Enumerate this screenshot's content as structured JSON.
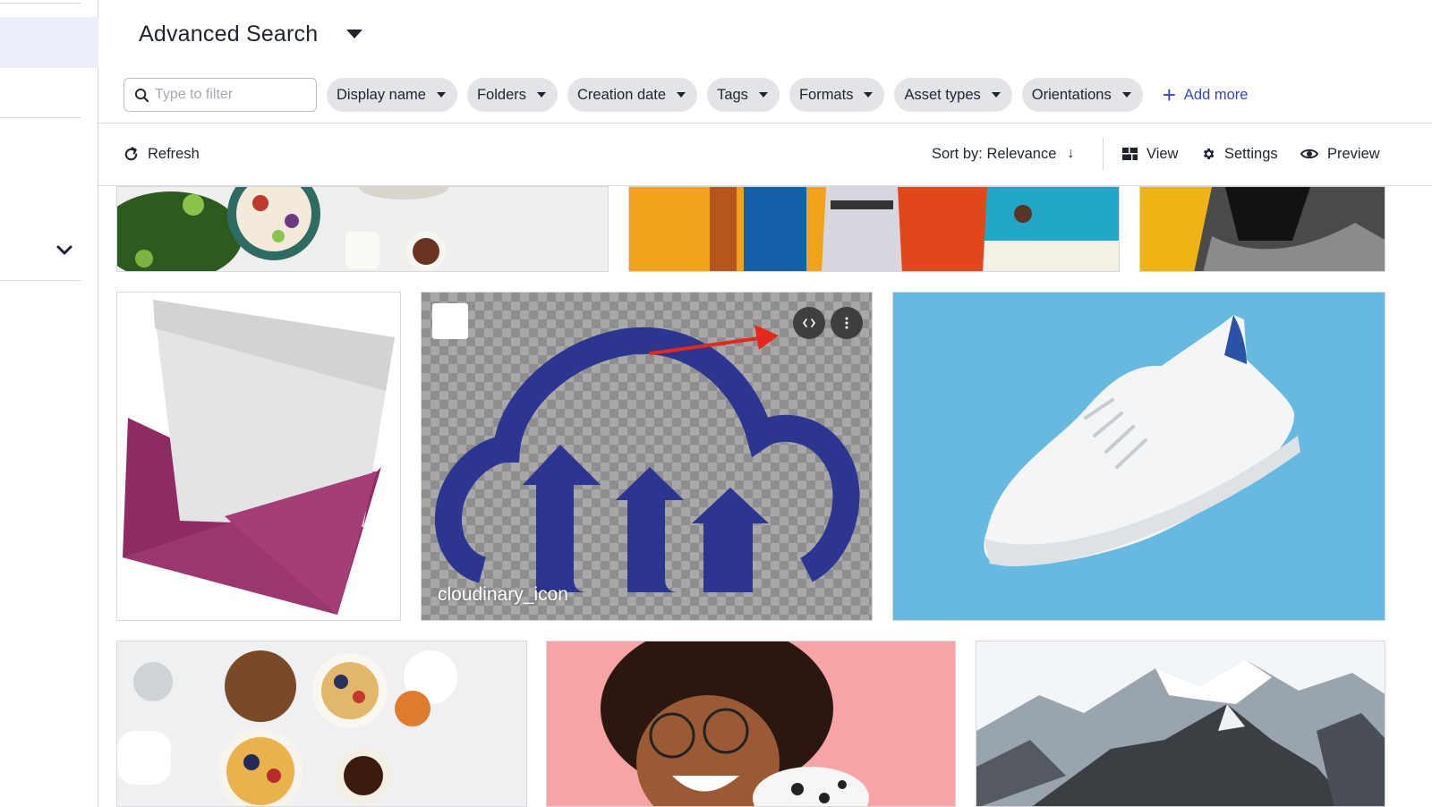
{
  "header": {
    "title": "Advanced Search"
  },
  "filters": {
    "search_placeholder": "Type to filter",
    "chips": [
      {
        "label": "Display name"
      },
      {
        "label": "Folders"
      },
      {
        "label": "Creation date"
      },
      {
        "label": "Tags"
      },
      {
        "label": "Formats"
      },
      {
        "label": "Asset types"
      },
      {
        "label": "Orientations"
      }
    ],
    "add_more": "Add more"
  },
  "toolbar": {
    "refresh": "Refresh",
    "sort": "Sort by: Relevance",
    "view": "View",
    "settings": "Settings",
    "preview": "Preview"
  },
  "assets": {
    "featured_label": "cloudinary_icon"
  },
  "icons": {
    "search": "search-icon",
    "refresh": "refresh-icon",
    "view": "grid-view-icon",
    "settings": "gear-icon",
    "preview": "eye-icon",
    "code": "code-icon",
    "more": "more-vertical-icon",
    "chevron": "chevron-down-icon"
  },
  "colors": {
    "accent": "#3448c5",
    "chip_bg": "#e3e4e7",
    "sidebar_active": "#eceefa",
    "annotation_arrow": "#e8271c",
    "cloudinary_blue": "#2c3690"
  }
}
